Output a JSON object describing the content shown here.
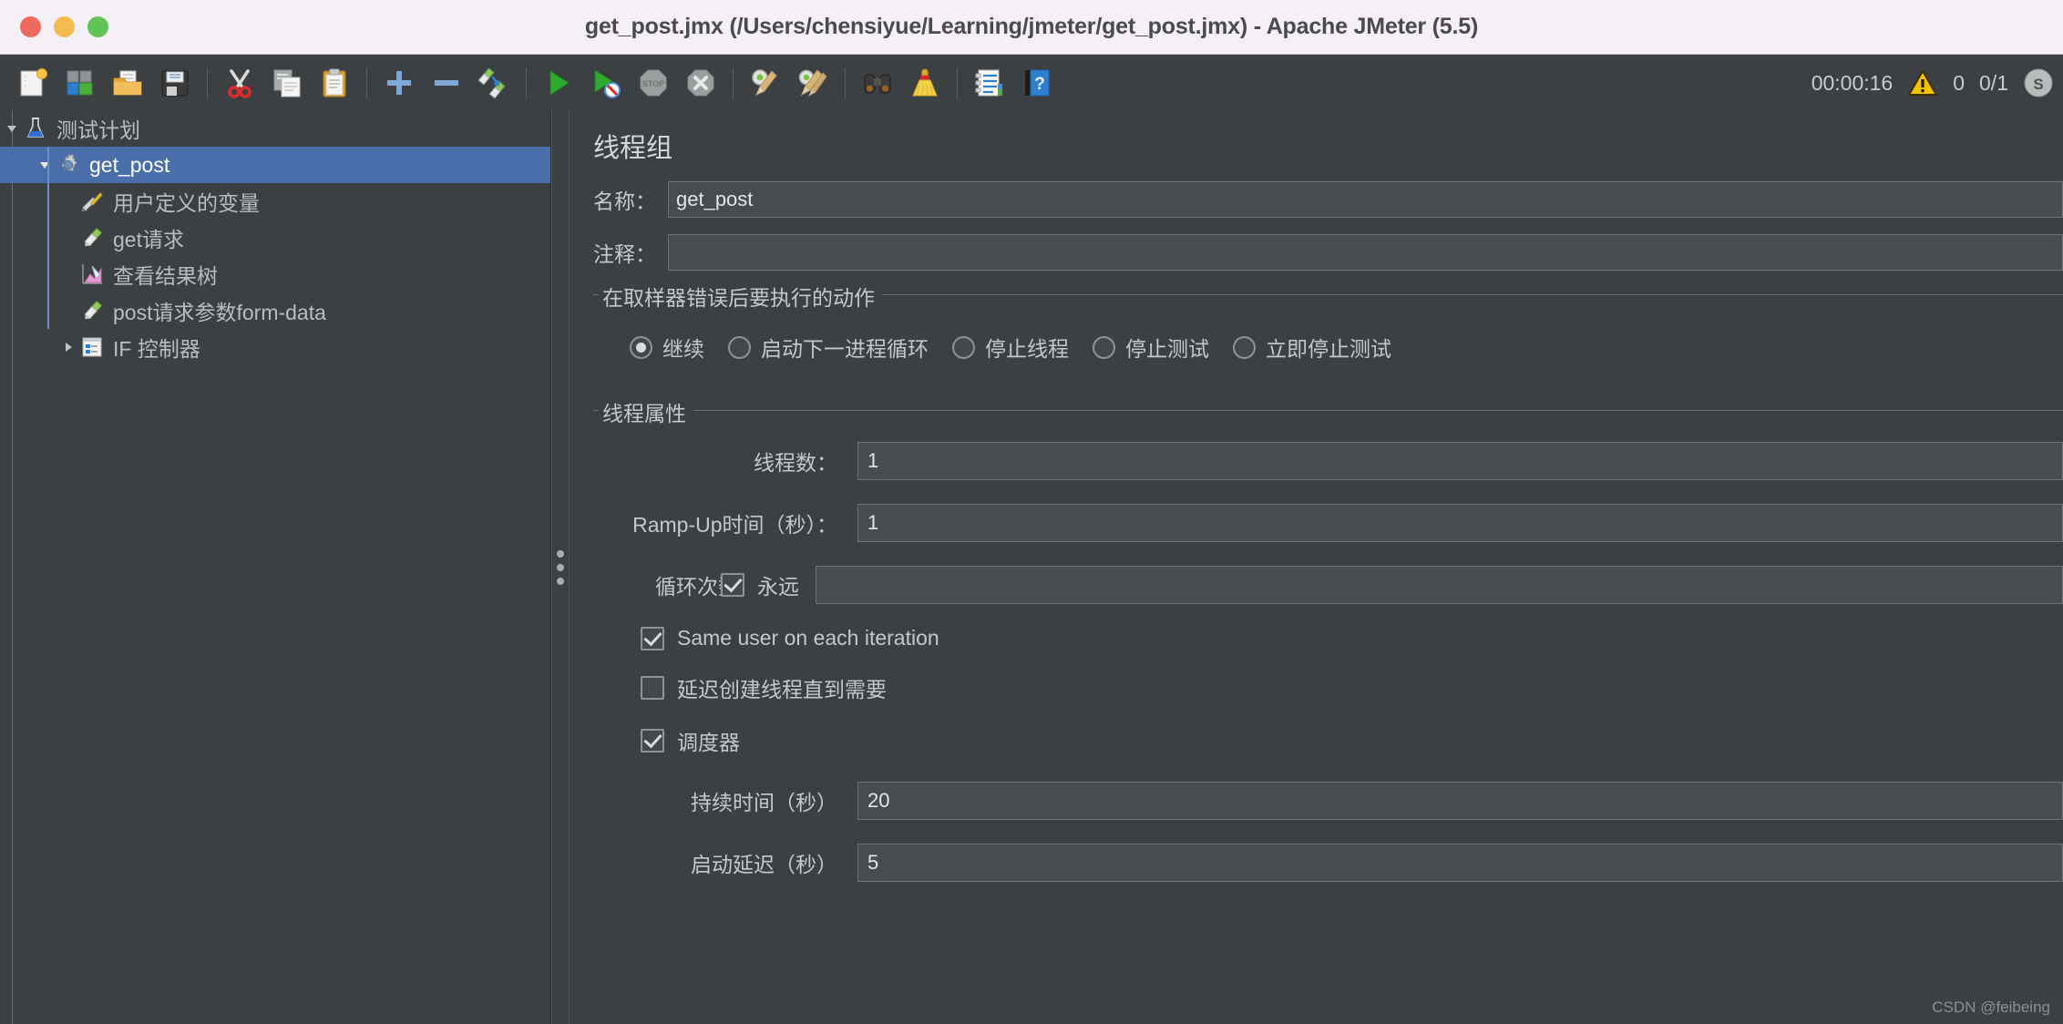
{
  "window": {
    "title": "get_post.jmx (/Users/chensiyue/Learning/jmeter/get_post.jmx) - Apache JMeter (5.5)"
  },
  "toolbar": {
    "buttons": [
      {
        "name": "new-button",
        "icon": "new-document-icon",
        "tooltip": "New"
      },
      {
        "name": "templates-button",
        "icon": "templates-icon",
        "tooltip": "Templates"
      },
      {
        "name": "open-button",
        "icon": "open-folder-icon",
        "tooltip": "Open"
      },
      {
        "name": "save-button",
        "icon": "save-floppy-icon",
        "tooltip": "Save"
      },
      {
        "name": "cut-button",
        "icon": "scissors-icon",
        "tooltip": "Cut"
      },
      {
        "name": "copy-button",
        "icon": "copy-icon",
        "tooltip": "Copy"
      },
      {
        "name": "paste-button",
        "icon": "clipboard-paste-icon",
        "tooltip": "Paste"
      },
      {
        "name": "expand-all-button",
        "icon": "plus-icon",
        "tooltip": "Expand All"
      },
      {
        "name": "collapse-all-button",
        "icon": "minus-icon",
        "tooltip": "Collapse All"
      },
      {
        "name": "toggle-button",
        "icon": "toggle-test-element-icon",
        "tooltip": "Toggle"
      },
      {
        "name": "start-button",
        "icon": "play-green-icon",
        "tooltip": "Start"
      },
      {
        "name": "start-no-pauses-button",
        "icon": "play-no-pauses-icon",
        "tooltip": "Start no pauses"
      },
      {
        "name": "stop-button",
        "icon": "stop-icon",
        "tooltip": "Stop"
      },
      {
        "name": "shutdown-button",
        "icon": "shutdown-icon",
        "tooltip": "Shutdown"
      },
      {
        "name": "clear-button",
        "icon": "clear-broom-icon",
        "tooltip": "Clear"
      },
      {
        "name": "clear-all-button",
        "icon": "clear-all-broom-icon",
        "tooltip": "Clear All"
      },
      {
        "name": "search-button",
        "icon": "binoculars-icon",
        "tooltip": "Search"
      },
      {
        "name": "reset-search-button",
        "icon": "reset-search-broom-icon",
        "tooltip": "Reset Search"
      },
      {
        "name": "function-helper-button",
        "icon": "function-helper-icon",
        "tooltip": "Function Helper Dialog"
      },
      {
        "name": "help-button",
        "icon": "help-book-icon",
        "tooltip": "Help"
      }
    ]
  },
  "status": {
    "elapsed": "00:00:16",
    "warning_icon": "warning-triangle-icon",
    "warning_count": "0",
    "threads": "0/1"
  },
  "tree": {
    "nodes": [
      {
        "label": "测试计划",
        "icon": "test-plan-flask-icon",
        "depth": 0,
        "twisty": "down",
        "selected": false
      },
      {
        "label": "get_post",
        "icon": "thread-group-gear-icon",
        "depth": 1,
        "twisty": "down",
        "selected": true
      },
      {
        "label": "用户定义的变量",
        "icon": "user-defined-variables-icon",
        "depth": 2,
        "twisty": "none",
        "selected": false
      },
      {
        "label": "get请求",
        "icon": "http-sampler-icon",
        "depth": 2,
        "twisty": "none",
        "selected": false
      },
      {
        "label": "查看结果树",
        "icon": "view-results-tree-icon",
        "depth": 2,
        "twisty": "none",
        "selected": false
      },
      {
        "label": "post请求参数form-data",
        "icon": "http-sampler-icon",
        "depth": 2,
        "twisty": "none",
        "selected": false
      },
      {
        "label": "IF 控制器",
        "icon": "if-controller-icon",
        "depth": 2,
        "twisty": "right",
        "selected": false
      }
    ]
  },
  "panel": {
    "title": "线程组",
    "name_label": "名称：",
    "name_value": "get_post",
    "comment_label": "注释：",
    "comment_value": "",
    "error_action": {
      "legend": "在取样器错误后要执行的动作",
      "options": [
        {
          "label": "继续",
          "checked": true
        },
        {
          "label": "启动下一进程循环",
          "checked": false
        },
        {
          "label": "停止线程",
          "checked": false
        },
        {
          "label": "停止测试",
          "checked": false
        },
        {
          "label": "立即停止测试",
          "checked": false
        }
      ]
    },
    "thread_properties": {
      "legend": "线程属性",
      "num_threads_label": "线程数：",
      "num_threads_value": "1",
      "ramp_up_label": "Ramp-Up时间（秒）：",
      "ramp_up_value": "1",
      "loop_count_label": "循环次数",
      "loop_forever_label": "永远",
      "loop_forever_checked": true,
      "loop_count_value": "",
      "same_user_label": "Same user on each iteration",
      "same_user_checked": true,
      "delayed_start_label": "延迟创建线程直到需要",
      "delayed_start_checked": false,
      "scheduler_label": "调度器",
      "scheduler_checked": true,
      "duration_label": "持续时间（秒）",
      "duration_value": "20",
      "startup_delay_label": "启动延迟（秒）",
      "startup_delay_value": "5"
    }
  },
  "watermark": "CSDN @feibeing",
  "colors": {
    "window_bg": "#3c4043",
    "titlebar_bg": "#f4f0f5",
    "selection_blue": "#4a6ea9",
    "field_bg": "#484c4f",
    "text": "#c4c8c9",
    "accent_warning": "#f2c200"
  }
}
